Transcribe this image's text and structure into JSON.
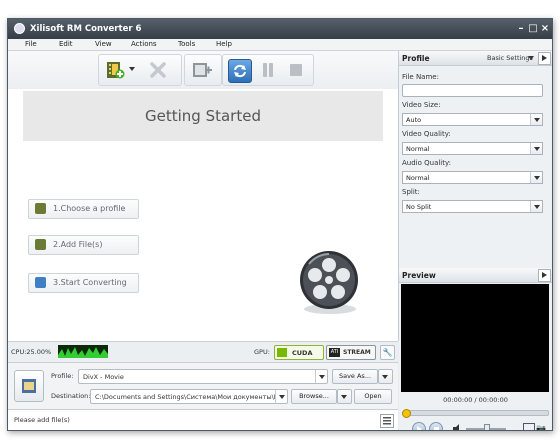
{
  "window": {
    "title": "Xilisoft RM Converter 6"
  },
  "menu": [
    "File",
    "Edit",
    "View",
    "Actions",
    "Tools",
    "Help"
  ],
  "main": {
    "heading": "Getting Started",
    "steps": [
      "1.Choose a profile",
      "2.Add File(s)",
      "3.Start Converting"
    ]
  },
  "bottom": {
    "cpu": "CPU:25.00%",
    "gpu_label": "GPU:",
    "cuda": "CUDA",
    "stream": "STREAM",
    "profile_label": "Profile:",
    "profile_value": "DivX - Movie",
    "save_as": "Save As...",
    "destination_label": "Destination:",
    "destination_value": "C:\\Documents and Settings\\Система\\Мои документы\\Мои ви",
    "browse": "Browse...",
    "open": "Open",
    "status": "Please add file(s)"
  },
  "profile_panel": {
    "title": "Profile",
    "settings_dropdown": "Basic Settings",
    "file_name_label": "File Name:",
    "file_name_value": "",
    "video_size_label": "Video Size:",
    "video_size_value": "Auto",
    "video_quality_label": "Video Quality:",
    "video_quality_value": "Normal",
    "audio_quality_label": "Audio Quality:",
    "audio_quality_value": "Normal",
    "split_label": "Split:",
    "split_value": "No Split"
  },
  "preview": {
    "title": "Preview",
    "time": "00:00:00 / 00:00:00",
    "progress": 0,
    "volume": 0.5
  },
  "colors": {
    "accent": "#3a7ec9",
    "titlebar": "#3f4852",
    "cuda": "#76b900"
  }
}
